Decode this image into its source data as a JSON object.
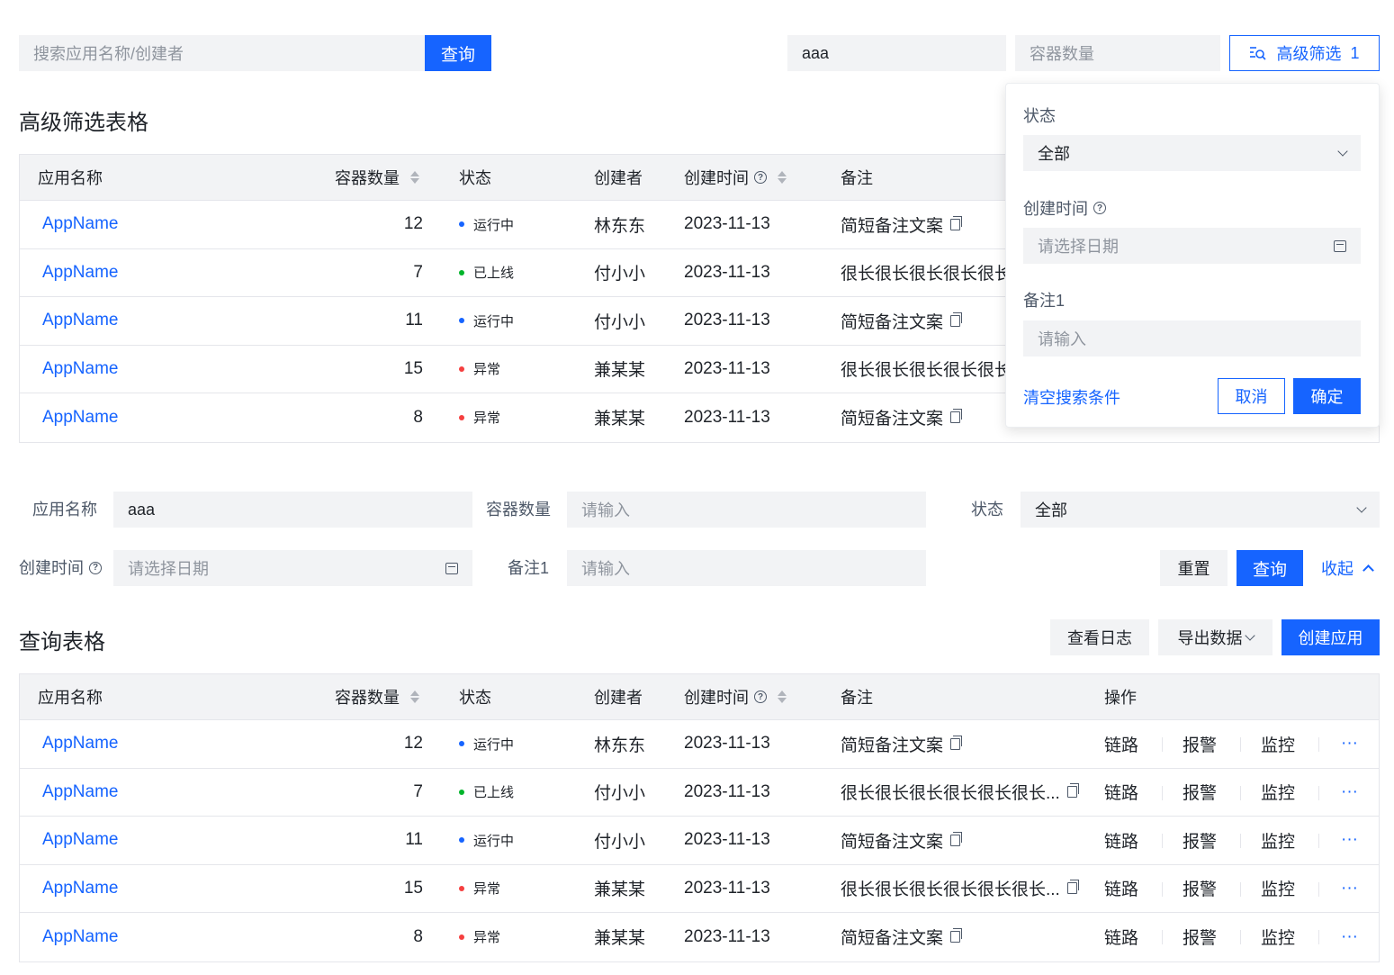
{
  "top_bar": {
    "search_placeholder": "搜索应用名称/创建者",
    "search_button": "查询",
    "filter_value": "aaa",
    "container_placeholder": "容器数量",
    "advanced_filter_label": "高级筛选",
    "advanced_filter_count": "1"
  },
  "advanced_table": {
    "title": "高级筛选表格",
    "columns": [
      "应用名称",
      "容器数量",
      "状态",
      "创建者",
      "创建时间",
      "备注"
    ],
    "rows": [
      {
        "name": "AppName",
        "count": "12",
        "status": "运行中",
        "status_color": "#1664ff",
        "creator": "林东东",
        "date": "2023-11-13",
        "note": "简短备注文案",
        "copy": true
      },
      {
        "name": "AppName",
        "count": "7",
        "status": "已上线",
        "status_color": "#00b42a",
        "creator": "付小小",
        "date": "2023-11-13",
        "note": "很长很长很长很长很长很",
        "copy": false
      },
      {
        "name": "AppName",
        "count": "11",
        "status": "运行中",
        "status_color": "#1664ff",
        "creator": "付小小",
        "date": "2023-11-13",
        "note": "简短备注文案",
        "copy": true
      },
      {
        "name": "AppName",
        "count": "15",
        "status": "异常",
        "status_color": "#f53f3f",
        "creator": "兼某某",
        "date": "2023-11-13",
        "note": "很长很长很长很长很长很",
        "copy": false
      },
      {
        "name": "AppName",
        "count": "8",
        "status": "异常",
        "status_color": "#f53f3f",
        "creator": "兼某某",
        "date": "2023-11-13",
        "note": "简短备注文案",
        "copy": true
      }
    ]
  },
  "popover": {
    "status_label": "状态",
    "status_value": "全部",
    "created_label": "创建时间",
    "date_placeholder": "请选择日期",
    "note_label": "备注1",
    "note_placeholder": "请输入",
    "clear_link": "清空搜索条件",
    "cancel": "取消",
    "confirm": "确定"
  },
  "query_form": {
    "app_name_label": "应用名称",
    "app_name_value": "aaa",
    "container_label": "容器数量",
    "container_placeholder": "请输入",
    "status_label": "状态",
    "status_value": "全部",
    "created_label": "创建时间",
    "date_placeholder": "请选择日期",
    "note_label": "备注1",
    "note_placeholder": "请输入",
    "reset": "重置",
    "query": "查询",
    "collapse": "收起"
  },
  "query_table": {
    "title": "查询表格",
    "view_log": "查看日志",
    "export": "导出数据",
    "create": "创建应用",
    "columns": [
      "应用名称",
      "容器数量",
      "状态",
      "创建者",
      "创建时间",
      "备注",
      "操作"
    ],
    "actions": [
      "链路",
      "报警",
      "监控",
      "···"
    ],
    "rows": [
      {
        "name": "AppName",
        "count": "12",
        "status": "运行中",
        "status_color": "#1664ff",
        "creator": "林东东",
        "date": "2023-11-13",
        "note": "简短备注文案"
      },
      {
        "name": "AppName",
        "count": "7",
        "status": "已上线",
        "status_color": "#00b42a",
        "creator": "付小小",
        "date": "2023-11-13",
        "note": "很长很长很长很长很长很长..."
      },
      {
        "name": "AppName",
        "count": "11",
        "status": "运行中",
        "status_color": "#1664ff",
        "creator": "付小小",
        "date": "2023-11-13",
        "note": "简短备注文案"
      },
      {
        "name": "AppName",
        "count": "15",
        "status": "异常",
        "status_color": "#f53f3f",
        "creator": "兼某某",
        "date": "2023-11-13",
        "note": "很长很长很长很长很长很长..."
      },
      {
        "name": "AppName",
        "count": "8",
        "status": "异常",
        "status_color": "#f53f3f",
        "creator": "兼某某",
        "date": "2023-11-13",
        "note": "简短备注文案"
      }
    ]
  },
  "colors": {
    "primary": "#1664ff",
    "running": "#1664ff",
    "online": "#00b42a",
    "error": "#f53f3f"
  }
}
